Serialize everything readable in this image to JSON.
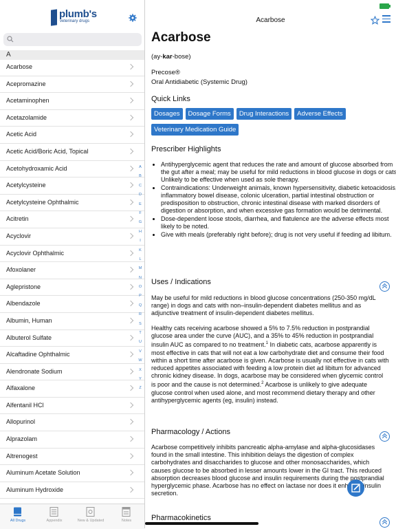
{
  "sidebar": {
    "logo_name": "plumb's",
    "logo_sub": "veterinary drugs",
    "search_placeholder": "",
    "section": "A",
    "items": [
      "Acarbose",
      "Acepromazine",
      "Acetaminophen",
      "Acetazolamide",
      "Acetic Acid",
      "Acetic Acid/Boric Acid, Topical",
      "Acetohydroxamic Acid",
      "Acetylcysteine",
      "Acetylcysteine Ophthalmic",
      "Acitretin",
      "Acyclovir",
      "Acyclovir Ophthalmic",
      "Afoxolaner",
      "Aglepristone",
      "Albendazole",
      "Albumin, Human",
      "Albuterol Sulfate",
      "Alcaftadine Ophthalmic",
      "Alendronate Sodium",
      "Alfaxalone",
      "Alfentanil HCl",
      "Allopurinol",
      "Alprazolam",
      "Altrenogest",
      "Aluminum Acetate Solution",
      "Aluminum Hydroxide"
    ],
    "index_letters": [
      "A",
      "B",
      "C",
      "D",
      "E",
      "F",
      "G",
      "H",
      "I",
      "K",
      "L",
      "M",
      "N",
      "O",
      "P",
      "Q",
      "R",
      "S",
      "T",
      "U",
      "V",
      "W",
      "X",
      "Y",
      "Z"
    ]
  },
  "tabs": [
    {
      "label": "All Drugs",
      "icon": "book-icon",
      "active": true
    },
    {
      "label": "Appendix",
      "icon": "list-icon",
      "active": false
    },
    {
      "label": "New & Updated",
      "icon": "document-icon",
      "active": false
    },
    {
      "label": "Notes",
      "icon": "notes-icon",
      "active": false
    }
  ],
  "header": {
    "title": "Acarbose"
  },
  "monograph": {
    "name": "Acarbose",
    "pronunciation_pre": "(ay-",
    "pronunciation_bold": "kar",
    "pronunciation_post": "-bose)",
    "trade_name": "Precose®",
    "drug_class": "Oral Antidiabetic (Systemic Drug)",
    "quick_links_title": "Quick Links",
    "quick_links": [
      "Dosages",
      "Dosage Forms",
      "Drug Interactions",
      "Adverse Effects",
      "Veterinary Medication Guide"
    ],
    "highlights_title": "Prescriber Highlights",
    "highlights": [
      "Antihyperglycemic agent that reduces the rate and amount of glucose absorbed from the gut after a meal; may be useful for mild reductions in blood glucose in dogs or cats. Unlikely to be effective when used as sole therapy.",
      "Contraindications: Underweight animals, known hypersensitivity, diabetic ketoacidosis, inflammatory bowel disease, colonic ulceration, partial intestinal obstruction or predisposition to obstruction, chronic intestinal disease with marked disorders of digestion or absorption, and when excessive gas formation would be detrimental.",
      "Dose-dependent loose stools, diarrhea, and flatulence are the adverse effects most likely to be noted.",
      "Give with meals (preferably right before); drug is not very useful if feeding ad libitum."
    ],
    "uses_title": "Uses / Indications",
    "uses_p1": "May be useful for mild reductions in blood glucose concentrations (250-350 mg/dL range) in dogs and cats with non–insulin-dependent diabetes mellitus and as adjunctive treatment of insulin-dependent diabetes mellitus.",
    "uses_p2a": "Healthy cats receiving acarbose showed a 5% to 7.5% reduction in postprandial glucose area under the curve (AUC), and a 35% to 45% reduction in postprandial insulin AUC as compared to no treatment.",
    "uses_p2_ref1": "1",
    "uses_p2b": " In diabetic cats, acarbose apparently is most effective in cats that will not eat a low carbohydrate diet and consume their food within a short time after acarbose is given. Acarbose is usually not effective in cats with reduced appetites associated with feeding a low protein diet ad libitum for advanced chronic kidney disease. In dogs, acarbose may be considered when glycemic control is poor and the cause is not determined.",
    "uses_p2_ref2": "2",
    "uses_p2c": " Acarbose is unlikely to give adequate glucose control when used alone, and most recommend dietary therapy and other antihyperglycemic agents (eg, insulin) instead.",
    "pharm_title": "Pharmacology / Actions",
    "pharm_p": "Acarbose competitively inhibits pancreatic alpha-amylase and alpha-glucosidases found in the small intestine. This inhibition delays the digestion of complex carbohydrates and disaccharides to glucose and other monosaccharides, which causes glucose to be absorbed in lesser amounts lower in the GI tract. This reduced absorption decreases blood glucose and insulin requirements during the postprandial hyperglycemic phase. Acarbose has no effect on lactase nor does it enhance insulin secretion.",
    "pk_title": "Pharmacokinetics"
  },
  "colors": {
    "accent": "#2e77c9",
    "brand": "#1f4f8f",
    "battery": "#2aa64a"
  }
}
